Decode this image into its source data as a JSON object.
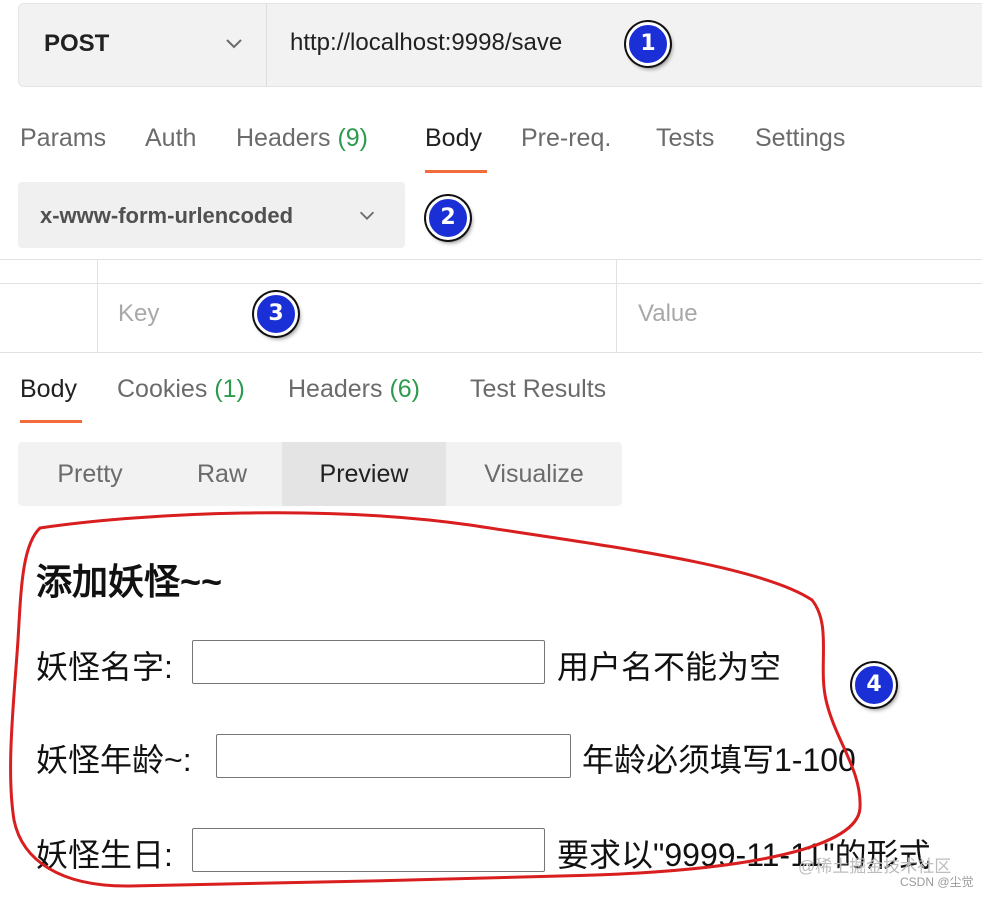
{
  "request": {
    "method": "POST",
    "url": "http://localhost:9998/save",
    "tabs": [
      {
        "label": "Params",
        "count": ""
      },
      {
        "label": "Auth",
        "count": ""
      },
      {
        "label": "Headers",
        "count": "(9)"
      },
      {
        "label": "Body",
        "count": ""
      },
      {
        "label": "Pre-req.",
        "count": ""
      },
      {
        "label": "Tests",
        "count": ""
      },
      {
        "label": "Settings",
        "count": ""
      }
    ],
    "active_tab": "Body",
    "body_type": "x-www-form-urlencoded",
    "kv_headers": {
      "key": "Key",
      "value": "Value"
    }
  },
  "response": {
    "tabs": [
      {
        "label": "Body",
        "count": ""
      },
      {
        "label": "Cookies",
        "count": "(1)"
      },
      {
        "label": "Headers",
        "count": "(6)"
      },
      {
        "label": "Test Results",
        "count": ""
      }
    ],
    "view_modes": [
      "Pretty",
      "Raw",
      "Preview",
      "Visualize"
    ],
    "selected_view": "Preview"
  },
  "preview": {
    "title": "添加妖怪~~",
    "fields": [
      {
        "label": "妖怪名字:",
        "value": "",
        "message": "用户名不能为空"
      },
      {
        "label": "妖怪年龄~:",
        "value": "",
        "message": "年龄必须填写1-100"
      },
      {
        "label": "妖怪生日:",
        "value": "",
        "message": "要求以\"9999-11-11\"的形式"
      }
    ]
  },
  "annotations": {
    "badges": [
      "1",
      "2",
      "3",
      "4"
    ],
    "badge_color": "#1a2fd6",
    "circle_color": "#d81e1e"
  },
  "watermark": "@稀土掘金技术社区",
  "credit": "CSDN @尘觉",
  "colors": {
    "accent_underline": "#f26b3a",
    "count_green": "#2e9a4f"
  }
}
